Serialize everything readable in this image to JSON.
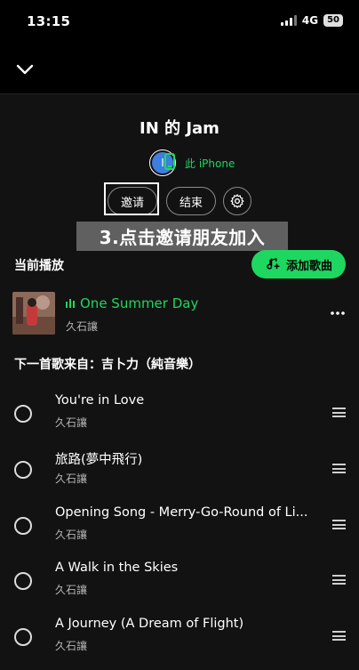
{
  "status": {
    "time": "13:15",
    "network": "4G",
    "battery": "50"
  },
  "header": {
    "title": "IN 的 Jam"
  },
  "host": {
    "avatar_initial": "I",
    "device_label": "此 iPhone"
  },
  "actions": {
    "invite_label": "邀请",
    "end_label": "结束"
  },
  "overlay": {
    "caption": "3.点击邀请朋友加入"
  },
  "now_playing": {
    "section_label": "当前播放",
    "add_song_label": "添加歌曲",
    "title": "One Summer Day",
    "artist": "久石讓"
  },
  "queue": {
    "heading": "下一首歌来自：吉卜力（純音樂）",
    "tracks": [
      {
        "title": "You're in Love",
        "artist": "久石讓"
      },
      {
        "title": "旅路(夢中飛行)",
        "artist": "久石讓"
      },
      {
        "title": "Opening Song - Merry-Go-Round of Li...",
        "artist": "久石讓"
      },
      {
        "title": "A Walk in the Skies",
        "artist": "久石讓"
      },
      {
        "title": "A Journey (A Dream of Flight)",
        "artist": "久石讓"
      }
    ]
  },
  "colors": {
    "accent": "#1ed760",
    "background": "#121212",
    "avatar": "#3d7ee0"
  },
  "icons": [
    "chevron-down-icon",
    "phone-icon",
    "gear-icon",
    "add-music-icon",
    "more-icon",
    "drag-handle-icon",
    "equalizer-icon"
  ]
}
